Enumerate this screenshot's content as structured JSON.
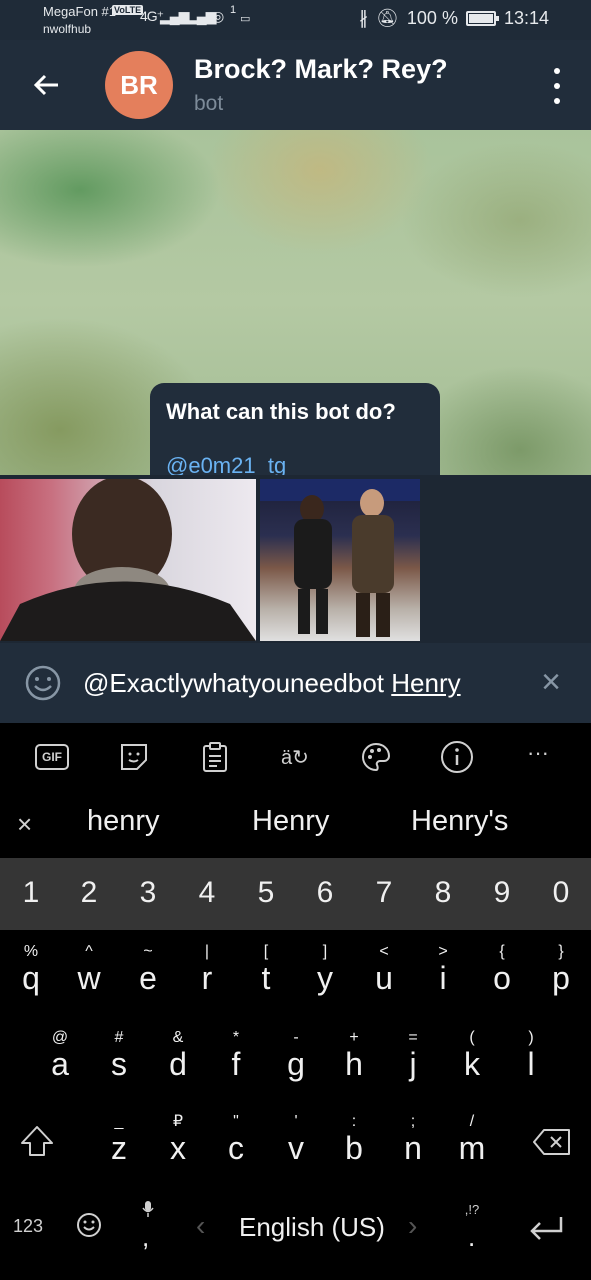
{
  "status_bar": {
    "carrier": "MegaFon #1",
    "volte": "VoLTE",
    "network": "4G⁺",
    "account": "nwolfhub",
    "wifi_badge": "1",
    "battery_percent": "100 %",
    "time": "13:14"
  },
  "header": {
    "avatar_initials": "BR",
    "avatar_color": "#e47f5c",
    "title": "Brock? Mark? Rey?",
    "subtitle": "bot"
  },
  "chat": {
    "bubble_title": "What can this bot do?",
    "bubble_link_partial": "@e0m21_tg"
  },
  "input": {
    "text_prefix": "@Exactlywhatyouneedbot ",
    "text_underlined": "Henry"
  },
  "keyboard": {
    "tools": [
      "GIF",
      "sticker-icon",
      "clipboard-icon",
      "translate-icon",
      "palette-icon",
      "info-icon",
      "more-icon"
    ],
    "suggestions": [
      "henry",
      "Henry",
      "Henry's"
    ],
    "numbers": [
      "1",
      "2",
      "3",
      "4",
      "5",
      "6",
      "7",
      "8",
      "9",
      "0"
    ],
    "row1": [
      {
        "pri": "q",
        "sec": "%"
      },
      {
        "pri": "w",
        "sec": "^"
      },
      {
        "pri": "e",
        "sec": "~"
      },
      {
        "pri": "r",
        "sec": "|"
      },
      {
        "pri": "t",
        "sec": "["
      },
      {
        "pri": "y",
        "sec": "]"
      },
      {
        "pri": "u",
        "sec": "<"
      },
      {
        "pri": "i",
        "sec": ">"
      },
      {
        "pri": "o",
        "sec": "{"
      },
      {
        "pri": "p",
        "sec": "}"
      }
    ],
    "row2": [
      {
        "pri": "a",
        "sec": "@"
      },
      {
        "pri": "s",
        "sec": "#"
      },
      {
        "pri": "d",
        "sec": "&"
      },
      {
        "pri": "f",
        "sec": "*"
      },
      {
        "pri": "g",
        "sec": "-"
      },
      {
        "pri": "h",
        "sec": "+"
      },
      {
        "pri": "j",
        "sec": "="
      },
      {
        "pri": "k",
        "sec": "("
      },
      {
        "pri": "l",
        "sec": ")"
      }
    ],
    "row3": [
      {
        "pri": "z",
        "sec": "_"
      },
      {
        "pri": "x",
        "sec": "₽"
      },
      {
        "pri": "c",
        "sec": "\""
      },
      {
        "pri": "v",
        "sec": "'"
      },
      {
        "pri": "b",
        "sec": ":"
      },
      {
        "pri": "n",
        "sec": ";"
      },
      {
        "pri": "m",
        "sec": "/"
      }
    ],
    "bottom": {
      "num_switch": "123",
      "comma": ",",
      "space_label": "English (US)",
      "punct_hint": ",!?",
      "period": "."
    }
  }
}
